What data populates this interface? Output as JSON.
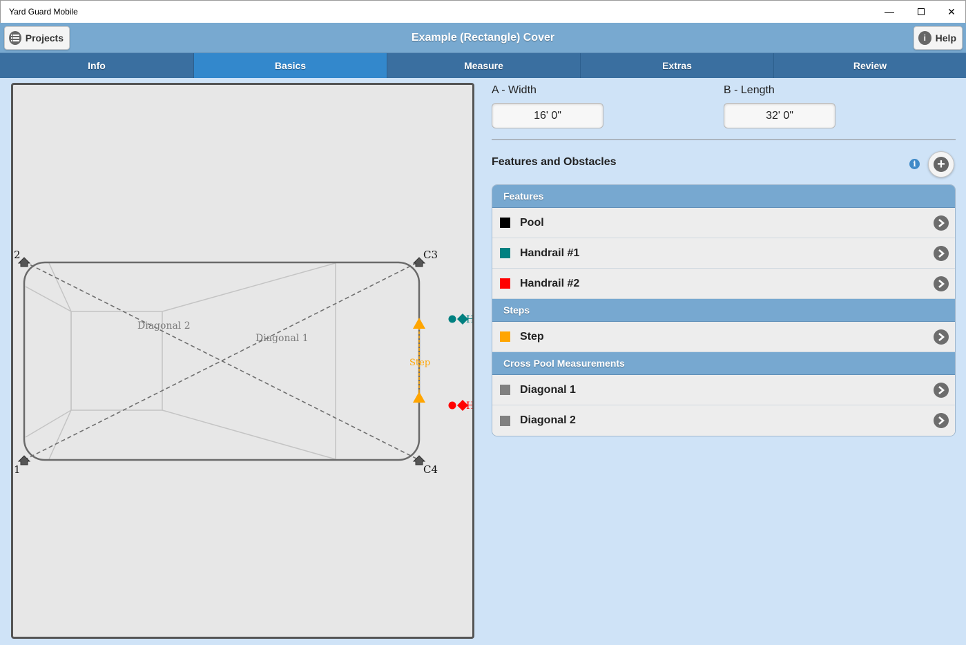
{
  "window": {
    "title": "Yard Guard Mobile",
    "min": "—",
    "close": "✕"
  },
  "header": {
    "title": "Example (Rectangle) Cover",
    "projects_label": "Projects",
    "help_label": "Help"
  },
  "tabs": [
    {
      "label": "Info",
      "active": false
    },
    {
      "label": "Basics",
      "active": true
    },
    {
      "label": "Measure",
      "active": false
    },
    {
      "label": "Extras",
      "active": false
    },
    {
      "label": "Review",
      "active": false
    }
  ],
  "diagram": {
    "corner_labels": [
      "2",
      "C3",
      "1",
      "C4"
    ],
    "line_labels": [
      "Diagonal 2",
      "Diagonal 1"
    ],
    "step_label": "Step",
    "handrail_marker": "H"
  },
  "dimensions": {
    "width_label": "A - Width",
    "width_value": "16' 0\"",
    "length_label": "B - Length",
    "length_value": "32' 0\""
  },
  "features_section": {
    "title": "Features and Obstacles",
    "info": "i",
    "add": "+",
    "groups": [
      {
        "label": "Features",
        "items": [
          {
            "label": "Pool",
            "color": "#000000"
          },
          {
            "label": "Handrail #1",
            "color": "#008080"
          },
          {
            "label": "Handrail #2",
            "color": "#ff0000"
          }
        ]
      },
      {
        "label": "Steps",
        "items": [
          {
            "label": "Step",
            "color": "#ffa500"
          }
        ]
      },
      {
        "label": "Cross Pool Measurements",
        "items": [
          {
            "label": "Diagonal 1",
            "color": "#808080"
          },
          {
            "label": "Diagonal 2",
            "color": "#808080"
          }
        ]
      }
    ]
  },
  "colors": {
    "header": "#78a9d0",
    "tab": "#3a6fa0",
    "tab_active": "#3388cc",
    "background": "#cfe3f7"
  }
}
